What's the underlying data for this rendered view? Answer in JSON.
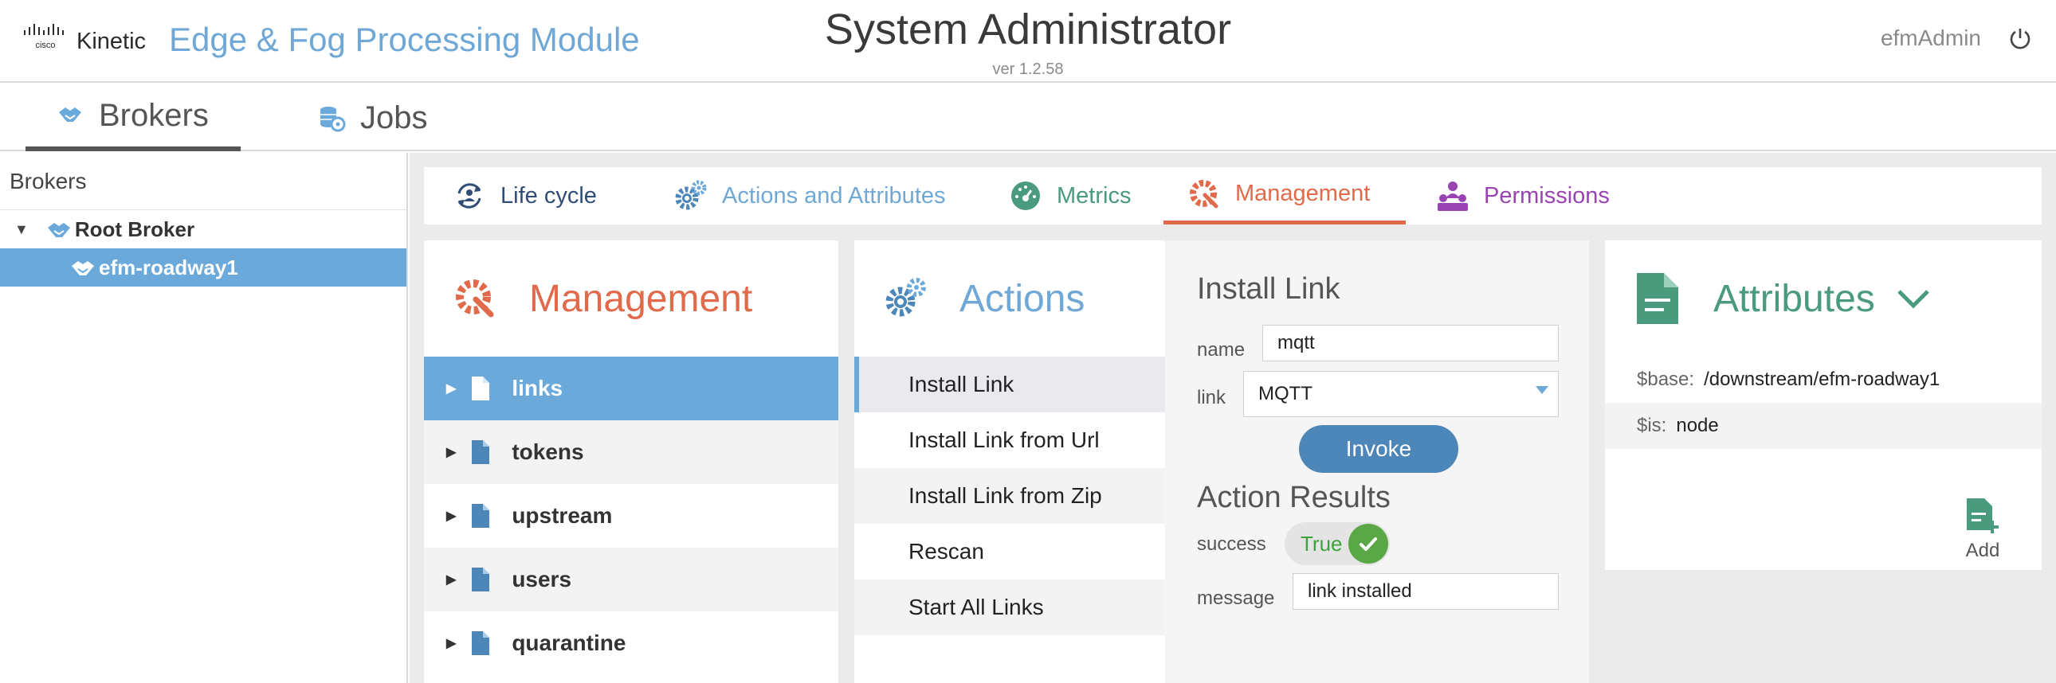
{
  "header": {
    "brand": "Kinetic",
    "app_title": "Edge & Fog Processing Module",
    "system_title": "System Administrator",
    "version": "ver 1.2.58",
    "user": "efmAdmin"
  },
  "main_tabs": [
    {
      "label": "Brokers",
      "icon": "brokers-handshake-icon",
      "active": true
    },
    {
      "label": "Jobs",
      "icon": "jobs-database-icon",
      "active": false
    }
  ],
  "left_panel": {
    "title": "Brokers",
    "tree": [
      {
        "label": "Root Broker",
        "expanded": true
      },
      {
        "label": "efm-roadway1",
        "selected": true
      }
    ]
  },
  "sub_tabs": [
    {
      "label": "Life cycle",
      "icon": "lifecycle-icon",
      "color": "#2e4e78"
    },
    {
      "label": "Actions and Attributes",
      "icon": "gears-icon",
      "color": "#6fa8d6"
    },
    {
      "label": "Metrics",
      "icon": "gauge-icon",
      "color": "#4a9a7e"
    },
    {
      "label": "Management",
      "icon": "gear-wrench-icon",
      "color": "#e06a4a",
      "active": true
    },
    {
      "label": "Permissions",
      "icon": "users-lock-icon",
      "color": "#9a44b4"
    }
  ],
  "management": {
    "title": "Management",
    "items": [
      {
        "label": "links",
        "selected": true
      },
      {
        "label": "tokens"
      },
      {
        "label": "upstream"
      },
      {
        "label": "users"
      },
      {
        "label": "quarantine"
      }
    ]
  },
  "actions": {
    "title": "Actions",
    "items": [
      {
        "label": "Install Link",
        "selected": true
      },
      {
        "label": "Install Link from Url"
      },
      {
        "label": "Install Link from Zip"
      },
      {
        "label": "Rescan"
      },
      {
        "label": "Start All Links"
      }
    ]
  },
  "action_form": {
    "title": "Install Link",
    "name_label": "name",
    "name_value": "mqtt",
    "link_label": "link",
    "link_value": "MQTT",
    "invoke_label": "Invoke",
    "results_title": "Action Results",
    "success_label": "success",
    "success_value": "True",
    "message_label": "message",
    "message_value": "link installed"
  },
  "attributes": {
    "title": "Attributes",
    "rows": [
      {
        "key": "$base:",
        "value": "/downstream/efm-roadway1"
      },
      {
        "key": "$is:",
        "value": "node"
      }
    ],
    "add_label": "Add"
  },
  "colors": {
    "accent_blue": "#6aa9da",
    "management_orange": "#e06a4a",
    "attributes_green": "#4a9a7e",
    "success_green": "#5aa845"
  }
}
